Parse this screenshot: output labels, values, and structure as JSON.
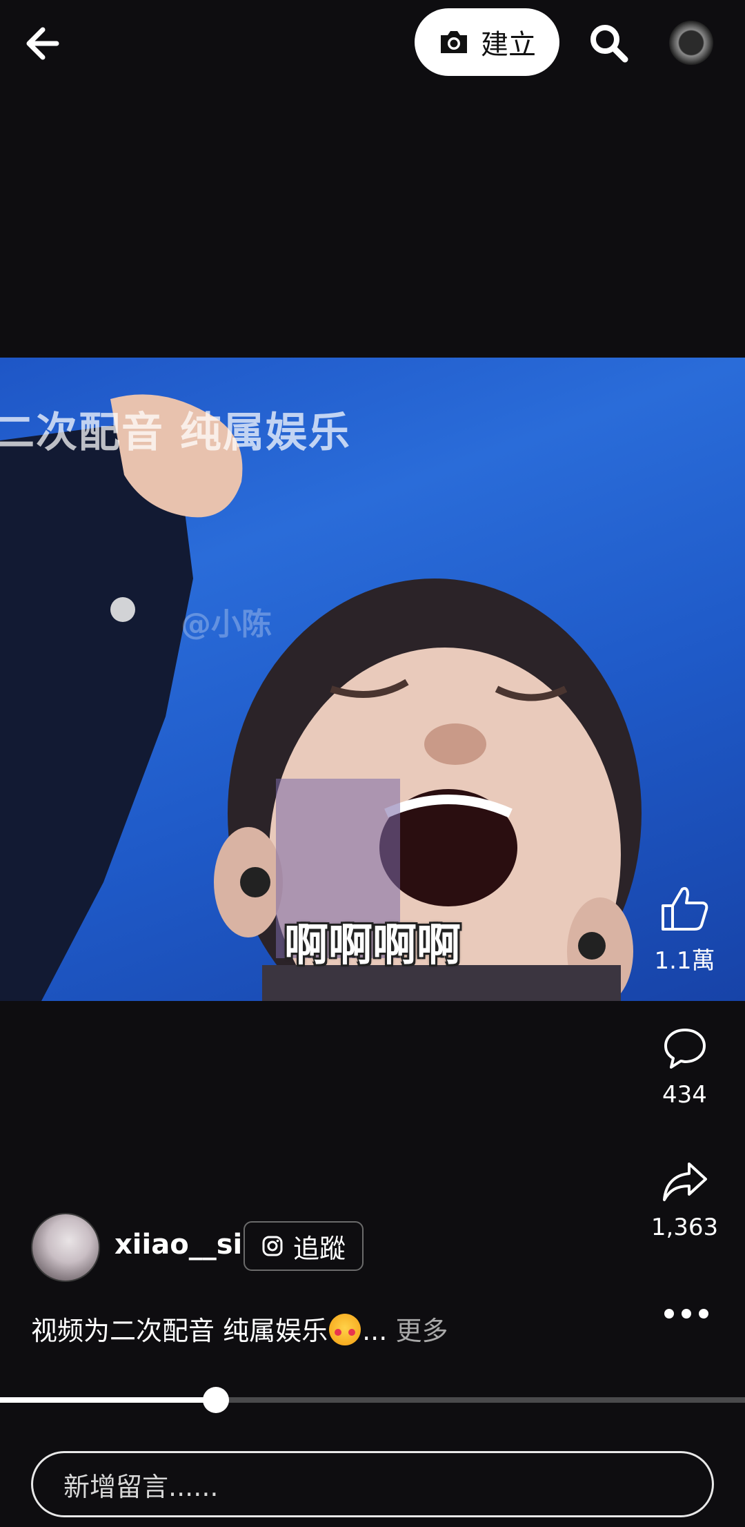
{
  "top_bar": {
    "create_label": "建立",
    "icons": {
      "back": "arrow-left-icon",
      "camera": "camera-icon",
      "search": "search-icon",
      "profile": "profile-avatar"
    }
  },
  "video": {
    "overlay_title": "二次配音 纯属娱乐",
    "watermark": "@小陈",
    "subtitle": "啊啊啊啊"
  },
  "actions": {
    "likes": "1.1萬",
    "comments": "434",
    "shares": "1,363"
  },
  "author": {
    "username": "xiiao__si",
    "follow_label": "追蹤"
  },
  "caption": {
    "text": "视频为二次配音 纯属娱乐",
    "ellipsis": "...",
    "more_label": "更多"
  },
  "playback": {
    "progress": 0.29
  },
  "comment": {
    "placeholder": "新增留言......"
  },
  "colors": {
    "background": "#0e0d10",
    "video_blue": "#2a6cd9",
    "text": "#ffffff",
    "muted": "#a9a9a9"
  }
}
